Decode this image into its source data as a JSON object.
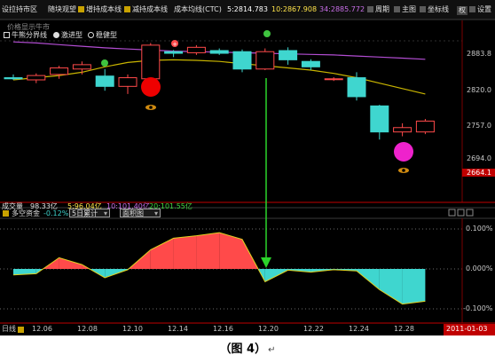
{
  "toolbar": {
    "items": [
      "设拉持市区",
      "随块观望",
      "增持成本线",
      "减持成本线",
      "成本均线(CTC)"
    ],
    "readouts": [
      "5:2814.783",
      "10:2867.908",
      "34:2885.772"
    ],
    "right_items": [
      "周期",
      "主图",
      "坐标线",
      "权",
      "设置"
    ]
  },
  "legend": {
    "items": [
      "牛熊分界线",
      "激进型",
      "稳健型"
    ],
    "overlay_text": "价格显示牛市"
  },
  "price_axis": {
    "labels": [
      "2883.8",
      "2820.0",
      "2757.0",
      "2694.0"
    ],
    "current": "2664.1"
  },
  "volume_bar": {
    "label": "成交量",
    "value": "98.33亿",
    "ma1": "5:96.04亿",
    "ma2": "10:101.40亿",
    "ma3": "20:101.55亿"
  },
  "indicator_bar": {
    "name": "多空资金",
    "value": "-0.12%",
    "dropdown": "5日累计",
    "style_select": "面积图"
  },
  "indicator_axis": {
    "labels": [
      "0.100%",
      "0.000%",
      "-0.100%"
    ]
  },
  "x_axis": {
    "period_label": "日线",
    "dates": [
      "12.06",
      "12.08",
      "12.10",
      "12.14",
      "12.16",
      "12.20",
      "12.22",
      "12.24",
      "12.28"
    ],
    "current_date": "2011-01-03"
  },
  "caption": {
    "text": "（图 4）",
    "mark": "↵"
  },
  "colors": {
    "bull": "#ff4a4a",
    "bear": "#3fd6cf",
    "ma_yellow": "#c8b400",
    "ma_purple": "#b24dd2",
    "arrow": "#2bd42b",
    "red_marker": "#ee0000",
    "magenta_marker": "#ee22cc"
  },
  "chart_data": {
    "type": "candlestick",
    "candles": [
      {
        "o": 2842,
        "h": 2848,
        "l": 2838,
        "c": 2840
      },
      {
        "o": 2838,
        "h": 2850,
        "l": 2832,
        "c": 2846
      },
      {
        "o": 2848,
        "h": 2864,
        "l": 2840,
        "c": 2860
      },
      {
        "o": 2858,
        "h": 2872,
        "l": 2848,
        "c": 2866
      },
      {
        "o": 2845,
        "h": 2858,
        "l": 2818,
        "c": 2826
      },
      {
        "o": 2826,
        "h": 2848,
        "l": 2812,
        "c": 2842
      },
      {
        "o": 2840,
        "h": 2906,
        "l": 2838,
        "c": 2902
      },
      {
        "o": 2890,
        "h": 2893,
        "l": 2880,
        "c": 2887
      },
      {
        "o": 2888,
        "h": 2902,
        "l": 2884,
        "c": 2898
      },
      {
        "o": 2892,
        "h": 2896,
        "l": 2884,
        "c": 2887
      },
      {
        "o": 2890,
        "h": 2894,
        "l": 2852,
        "c": 2858
      },
      {
        "o": 2858,
        "h": 2896,
        "l": 2856,
        "c": 2890
      },
      {
        "o": 2892,
        "h": 2898,
        "l": 2866,
        "c": 2875
      },
      {
        "o": 2872,
        "h": 2876,
        "l": 2856,
        "c": 2862
      },
      {
        "o": 2840,
        "h": 2843,
        "l": 2836,
        "c": 2840
      },
      {
        "o": 2842,
        "h": 2852,
        "l": 2800,
        "c": 2807
      },
      {
        "o": 2790,
        "h": 2792,
        "l": 2728,
        "c": 2742
      },
      {
        "o": 2742,
        "h": 2758,
        "l": 2734,
        "c": 2750
      },
      {
        "o": 2742,
        "h": 2766,
        "l": 2738,
        "c": 2762
      }
    ],
    "ma_yellow": [
      2838,
      2842,
      2846,
      2852,
      2862,
      2870,
      2874,
      2875,
      2874,
      2872,
      2868,
      2864,
      2860,
      2856,
      2850,
      2842,
      2832,
      2822,
      2812
    ],
    "ma_purple": [
      2908,
      2906,
      2903,
      2900,
      2897,
      2895,
      2893,
      2891,
      2890,
      2889,
      2888,
      2887,
      2886,
      2885,
      2884,
      2882,
      2880,
      2878,
      2876
    ],
    "flow": [
      -0.015,
      -0.012,
      0.028,
      0.011,
      -0.022,
      -0.002,
      0.048,
      0.077,
      0.083,
      0.091,
      0.074,
      -0.032,
      -0.003,
      -0.008,
      -0.002,
      -0.005,
      -0.052,
      -0.088,
      -0.081
    ]
  }
}
